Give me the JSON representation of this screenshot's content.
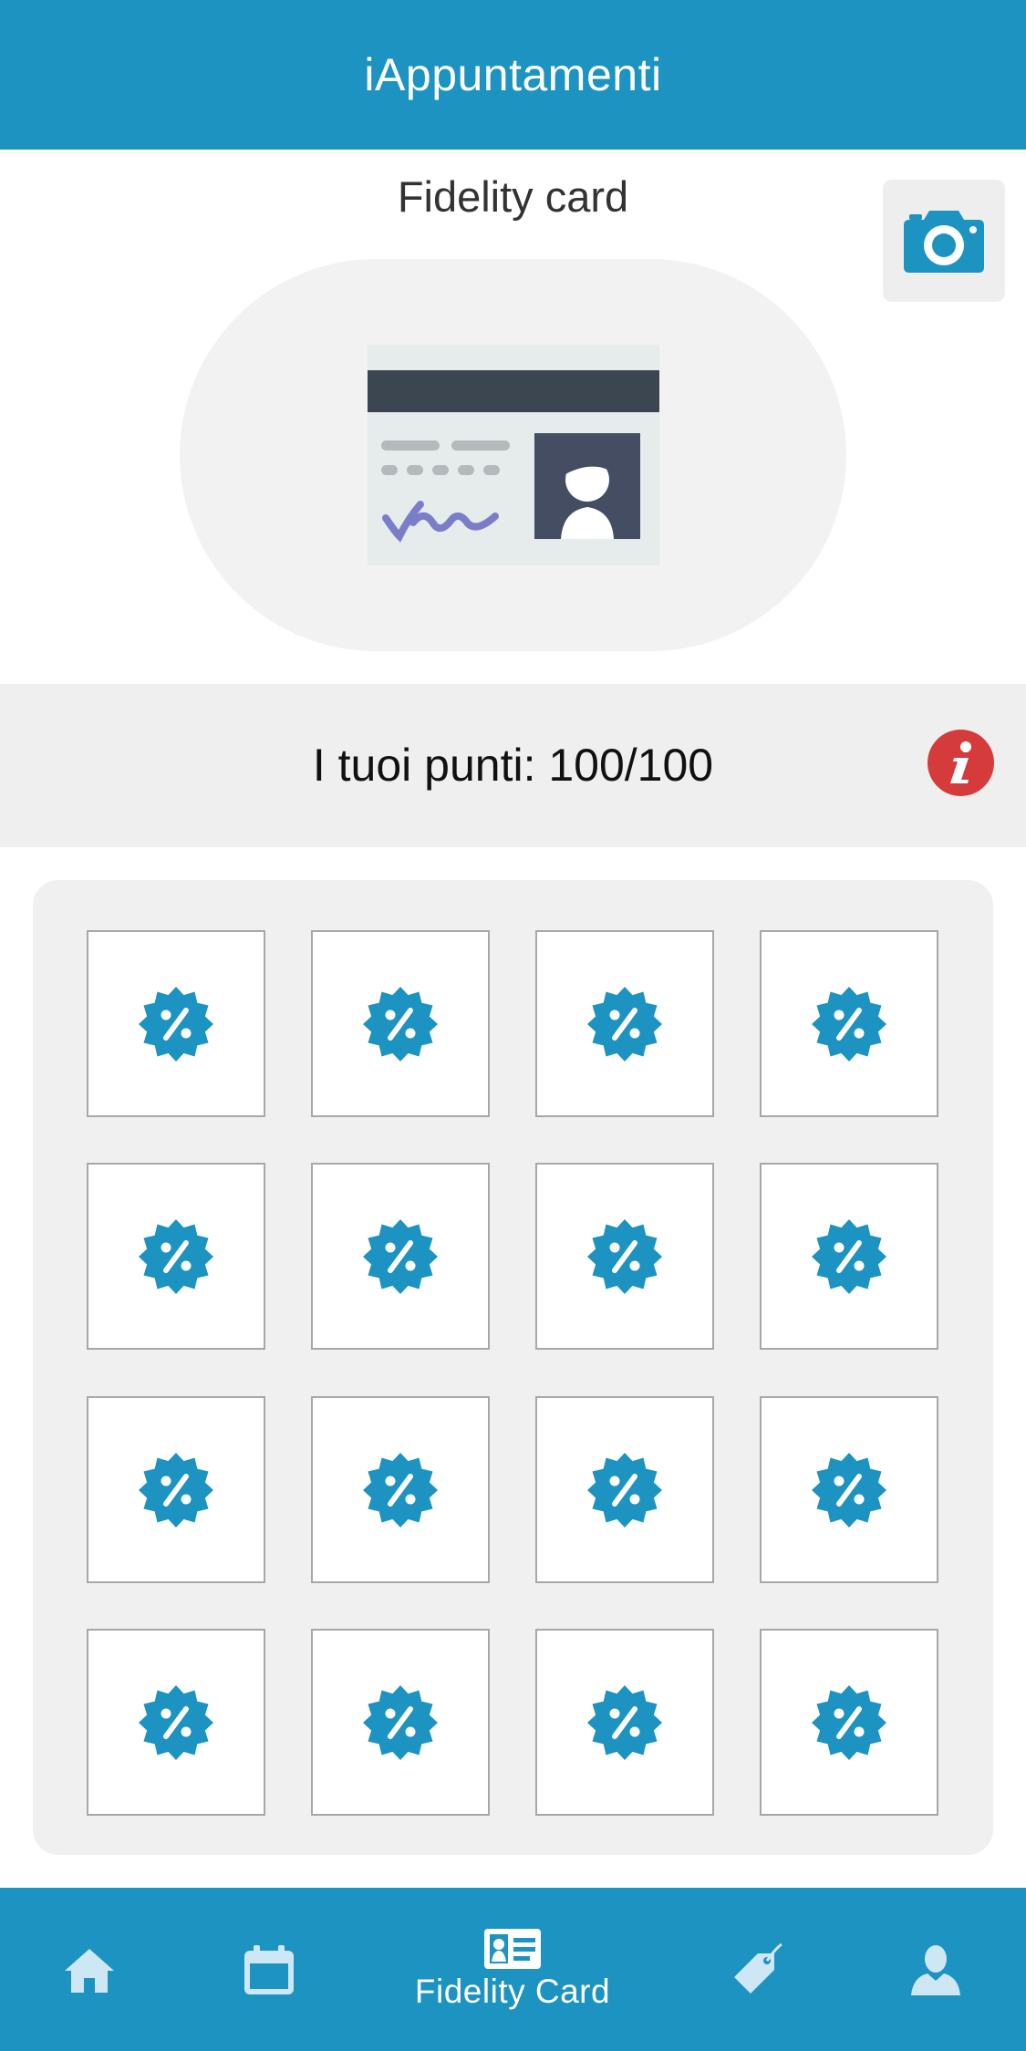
{
  "header": {
    "title": "iAppuntamenti"
  },
  "fidelity": {
    "title": "Fidelity card",
    "camera_icon": "camera-icon",
    "card_image_icon": "id-card-illustration"
  },
  "points": {
    "text": "I tuoi punti: 100/100",
    "info_icon": "info-icon"
  },
  "stamps": {
    "icon": "discount-badge-icon",
    "rows": 4,
    "cols": 4
  },
  "nav": {
    "items": [
      {
        "id": "home",
        "icon": "home-icon",
        "label": ""
      },
      {
        "id": "calendar",
        "icon": "calendar-icon",
        "label": ""
      },
      {
        "id": "fidelity",
        "icon": "id-card-icon",
        "label": "Fidelity Card",
        "active": true
      },
      {
        "id": "offers",
        "icon": "tag-icon",
        "label": ""
      },
      {
        "id": "profile",
        "icon": "user-icon",
        "label": ""
      }
    ]
  },
  "colors": {
    "primary": "#1c93c0",
    "info": "#d63b3b",
    "panel": "#f0f0f0"
  }
}
